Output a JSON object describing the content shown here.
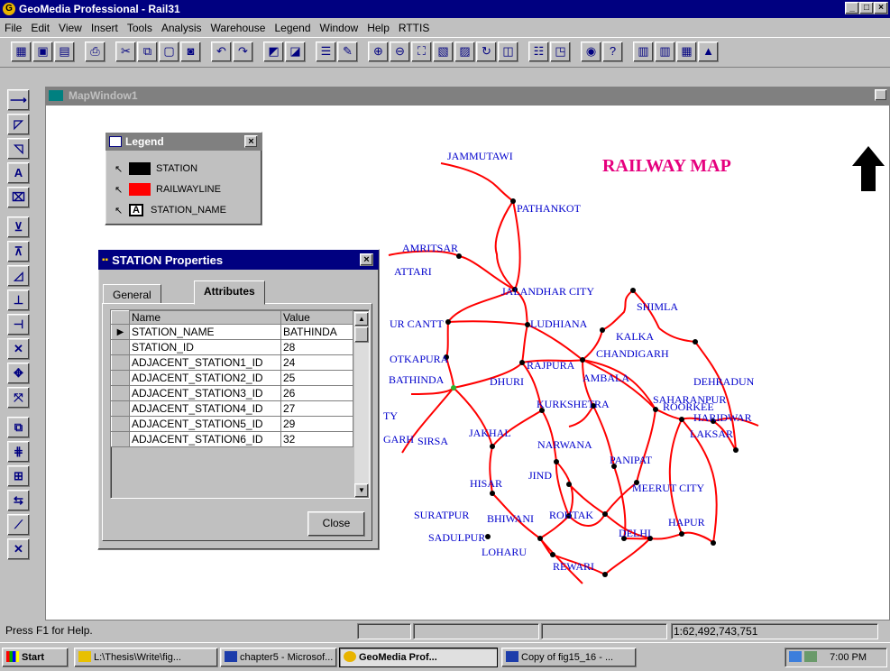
{
  "app": {
    "title": "GeoMedia Professional - Rail31",
    "menu": [
      "File",
      "Edit",
      "View",
      "Insert",
      "Tools",
      "Analysis",
      "Warehouse",
      "Legend",
      "Window",
      "Help",
      "RTTIS"
    ]
  },
  "map_window": {
    "title": "MapWindow1",
    "map_title": "RAILWAY MAP",
    "station_labels": [
      "JAMMUTAWI",
      "PATHANKOT",
      "AMRITSAR",
      "ATTARI",
      "JALANDHAR CITY",
      "SHIMLA",
      "UR CANTT",
      "LUDHIANA",
      "KALKA",
      "CHANDIGARH",
      "OTKAPURA",
      "RAJPURA",
      "AMBALA",
      "DEHRADUN",
      "BATHINDA",
      "DHURI",
      "KURKSHETRA",
      "SAHARANPUR",
      "ROORKEE",
      "HARIDWAR",
      "TY",
      "LAKSAR",
      "JAKHAL",
      "GARH",
      "SIRSA",
      "NARWANA",
      "PANIPAT",
      "JIND",
      "HISAR",
      "MEERUT CITY",
      "SURATPUR",
      "BHIWANI",
      "ROHTAK",
      "HAPUR",
      "DELHI",
      "SADULPUR",
      "LOHARU",
      "REWARI"
    ]
  },
  "legend": {
    "title": "Legend",
    "items": [
      {
        "label": "STATION",
        "color": "#000000"
      },
      {
        "label": "RAILWAYLINE",
        "color": "#ff0000"
      },
      {
        "label": "STATION_NAME",
        "color": "#ffffff"
      }
    ]
  },
  "properties_dialog": {
    "title": "STATION Properties",
    "tabs": [
      "General",
      "Attributes"
    ],
    "columns": [
      "Name",
      "Value"
    ],
    "rows": [
      {
        "name": "STATION_NAME",
        "value": "BATHINDA"
      },
      {
        "name": "STATION_ID",
        "value": "28"
      },
      {
        "name": "ADJACENT_STATION1_ID",
        "value": "24"
      },
      {
        "name": "ADJACENT_STATION2_ID",
        "value": "25"
      },
      {
        "name": "ADJACENT_STATION3_ID",
        "value": "26"
      },
      {
        "name": "ADJACENT_STATION4_ID",
        "value": "27"
      },
      {
        "name": "ADJACENT_STATION5_ID",
        "value": "29"
      },
      {
        "name": "ADJACENT_STATION6_ID",
        "value": "32"
      }
    ],
    "close_label": "Close"
  },
  "status": {
    "help_text": "Press F1 for Help.",
    "scale": "1:62,492,743,751"
  },
  "taskbar": {
    "start_label": "Start",
    "tasks": [
      "L:\\Thesis\\Write\\fig...",
      "chapter5 - Microsof...",
      "GeoMedia Prof...",
      "Copy of fig15_16 - ..."
    ],
    "clock": "7:00 PM"
  },
  "colors": {
    "title_active": "#000080",
    "title_inactive": "#808080",
    "map_title": "#e6007e",
    "station_label": "#0000cc",
    "rail_line": "#ff0000"
  }
}
